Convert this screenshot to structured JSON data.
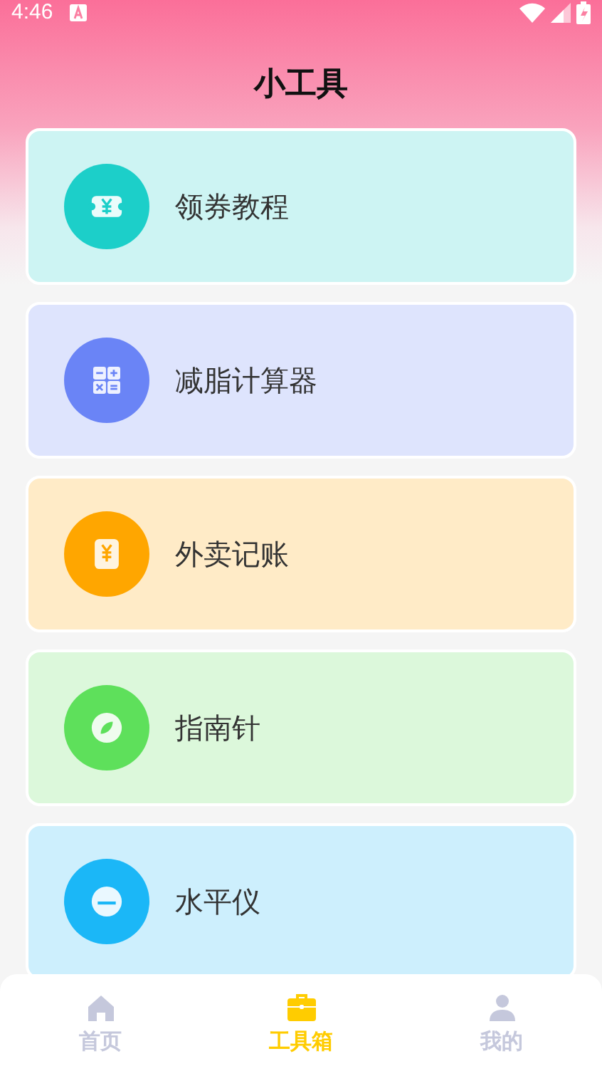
{
  "status_bar": {
    "time": "4:46"
  },
  "title": "小工具",
  "tools": [
    {
      "label": "领券教程",
      "color": "#1ccfc9"
    },
    {
      "label": "减脂计算器",
      "color": "#6a84f6"
    },
    {
      "label": "外卖记账",
      "color": "#ffa600"
    },
    {
      "label": "指南针",
      "color": "#5ee05b"
    },
    {
      "label": "水平仪",
      "color": "#1bb7f7"
    }
  ],
  "tabs": [
    {
      "label": "首页",
      "selected": false
    },
    {
      "label": "工具箱",
      "selected": true
    },
    {
      "label": "我的",
      "selected": false
    }
  ]
}
